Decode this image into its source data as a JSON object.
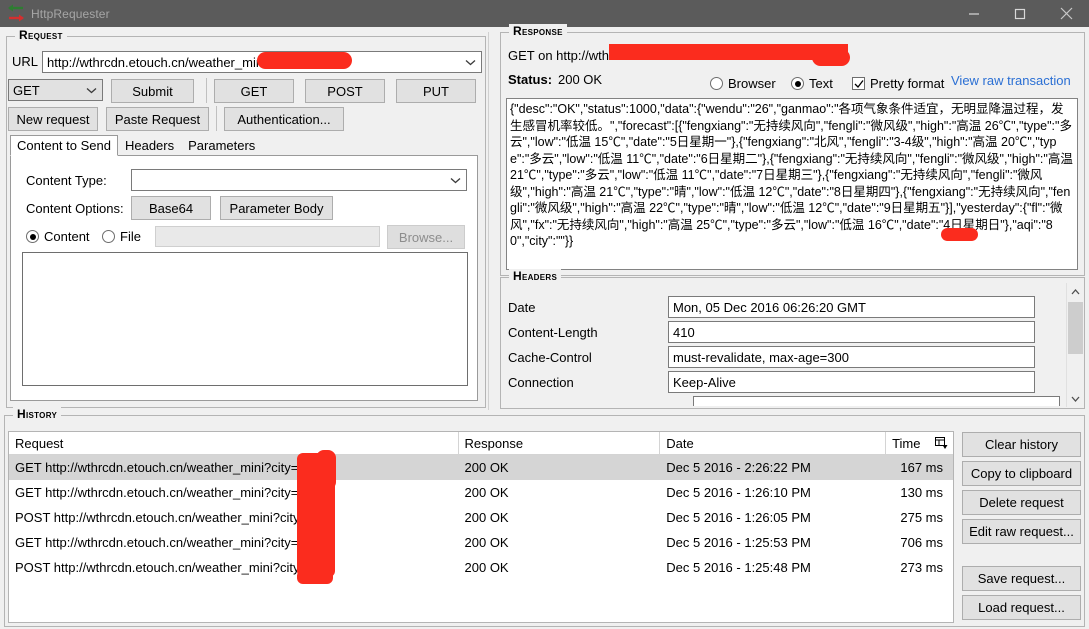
{
  "window": {
    "title": "HttpRequester",
    "icon": "arrows-icon",
    "minimize": "minimize-icon",
    "maximize": "maximize-icon",
    "close": "close-icon"
  },
  "request": {
    "group_label": "Request",
    "url_label": "URL",
    "url_value": "http://wthrcdn.etouch.cn/weather_mini",
    "method_selected": "GET",
    "buttons": {
      "submit": "Submit",
      "get": "GET",
      "post": "POST",
      "put": "PUT",
      "new_request": "New request",
      "paste_request": "Paste Request",
      "authentication": "Authentication..."
    },
    "tabs": [
      {
        "label": "Content to Send",
        "active": true
      },
      {
        "label": "Headers",
        "active": false
      },
      {
        "label": "Parameters",
        "active": false
      }
    ],
    "content_type_label": "Content Type:",
    "content_type_value": "",
    "content_options_label": "Content Options:",
    "base64_button": "Base64",
    "parameter_body_button": "Parameter Body",
    "content_radio": "Content",
    "file_radio": "File",
    "file_path_value": "",
    "browse_button": "Browse...",
    "body_value": ""
  },
  "response": {
    "group_label": "Response",
    "request_line": "GET on http://wthrcdn.e",
    "status_label": "Status:",
    "status_value": "200 OK",
    "view_browser": "Browser",
    "view_text": "Text",
    "pretty_format": "Pretty format",
    "view_raw_link": "View raw transaction",
    "body": "{\"desc\":\"OK\",\"status\":1000,\"data\":{\"wendu\":\"26\",\"ganmao\":\"各项气象条件适宜，无明显降温过程，发生感冒机率较低。\",\"forecast\":[{\"fengxiang\":\"无持续风向\",\"fengli\":\"微风级\",\"high\":\"高温 26℃\",\"type\":\"多云\",\"low\":\"低温 15℃\",\"date\":\"5日星期一\"},{\"fengxiang\":\"北风\",\"fengli\":\"3-4级\",\"high\":\"高温 20℃\",\"type\":\"多云\",\"low\":\"低温 11℃\",\"date\":\"6日星期二\"},{\"fengxiang\":\"无持续风向\",\"fengli\":\"微风级\",\"high\":\"高温 21℃\",\"type\":\"多云\",\"low\":\"低温 11℃\",\"date\":\"7日星期三\"},{\"fengxiang\":\"无持续风向\",\"fengli\":\"微风级\",\"high\":\"高温 21℃\",\"type\":\"晴\",\"low\":\"低温 12℃\",\"date\":\"8日星期四\"},{\"fengxiang\":\"无持续风向\",\"fengli\":\"微风级\",\"high\":\"高温 22℃\",\"type\":\"晴\",\"low\":\"低温 12℃\",\"date\":\"9日星期五\"}],\"yesterday\":{\"fl\":\"微风\",\"fx\":\"无持续风向\",\"high\":\"高温 25℃\",\"type\":\"多云\",\"low\":\"低温 16℃\",\"date\":\"4日星期日\"},\"aqi\":\"80\",\"city\":\"\"}}"
  },
  "headers": {
    "group_label": "Headers",
    "rows": [
      {
        "name": "Date",
        "value": "Mon, 05 Dec 2016 06:26:20 GMT"
      },
      {
        "name": "Content-Length",
        "value": "410"
      },
      {
        "name": "Cache-Control",
        "value": "must-revalidate, max-age=300"
      },
      {
        "name": "Connection",
        "value": "Keep-Alive"
      }
    ]
  },
  "history": {
    "group_label": "History",
    "columns": [
      "Request",
      "Response",
      "Date",
      "Time"
    ],
    "settings_icon": "column-settings-icon",
    "rows": [
      {
        "request": "GET http://wthrcdn.etouch.cn/weather_mini?city=",
        "response": "200 OK",
        "date": "Dec 5 2016 - 2:26:22 PM",
        "time": "167 ms",
        "selected": true
      },
      {
        "request": "GET http://wthrcdn.etouch.cn/weather_mini?city=",
        "response": "200 OK",
        "date": "Dec 5 2016 - 1:26:10 PM",
        "time": "130 ms",
        "selected": false
      },
      {
        "request": "POST http://wthrcdn.etouch.cn/weather_mini?city",
        "response": "200 OK",
        "date": "Dec 5 2016 - 1:26:05 PM",
        "time": "275 ms",
        "selected": false
      },
      {
        "request": "GET http://wthrcdn.etouch.cn/weather_mini?city=",
        "response": "200 OK",
        "date": "Dec 5 2016 - 1:25:53 PM",
        "time": "706 ms",
        "selected": false
      },
      {
        "request": "POST http://wthrcdn.etouch.cn/weather_mini?city",
        "response": "200 OK",
        "date": "Dec 5 2016 - 1:25:48 PM",
        "time": "273 ms",
        "selected": false
      }
    ],
    "buttons": [
      "Clear history",
      "Copy to clipboard",
      "Delete request",
      "Edit raw request...",
      "Save request...",
      "Load request..."
    ]
  },
  "colors": {
    "titlebar": "#5b5b5b",
    "redaction": "#fb2c1e",
    "link": "#2a6fd4",
    "selection": "#d5d5d5"
  }
}
